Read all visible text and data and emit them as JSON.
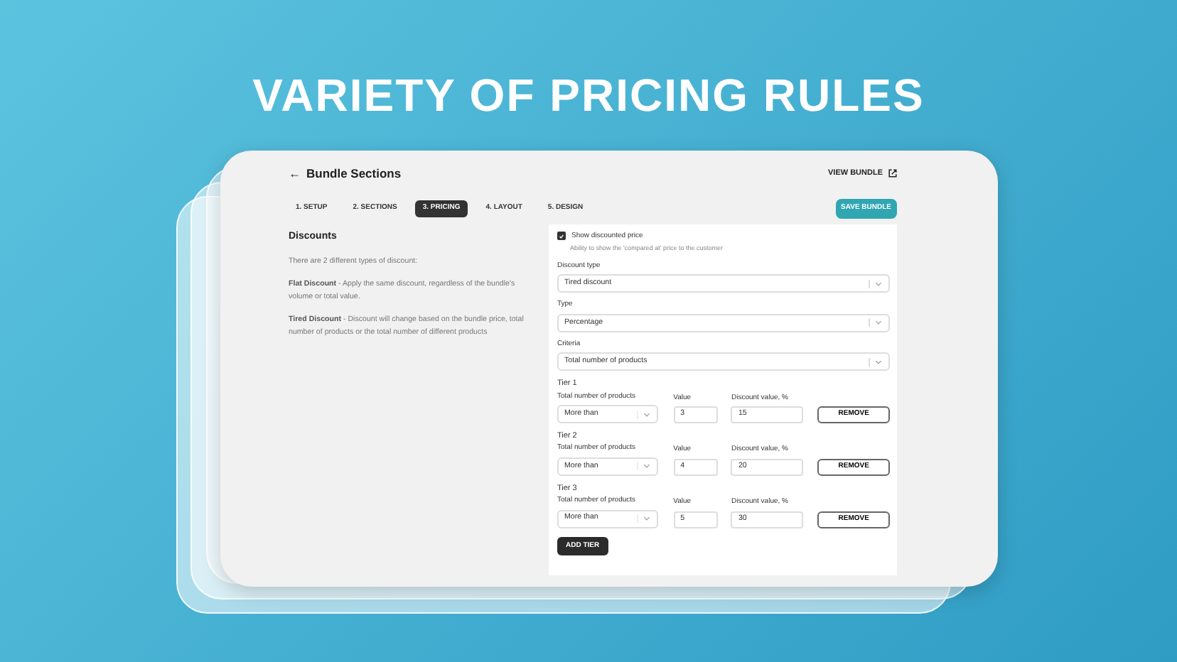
{
  "headline": "VARIETY OF PRICING RULES",
  "header": {
    "back_icon": "←",
    "title": "Bundle Sections",
    "view_link": "VIEW BUNDLE"
  },
  "tabs": [
    {
      "label": "1. SETUP",
      "selected": false
    },
    {
      "label": "2. SECTIONS",
      "selected": false
    },
    {
      "label": "3. PRICING",
      "selected": true
    },
    {
      "label": "4. LAYOUT",
      "selected": false
    },
    {
      "label": "5. DESIGN",
      "selected": false
    }
  ],
  "save_button": "SAVE BUNDLE",
  "info": {
    "title": "Discounts",
    "paragraphs": [
      "There are 2 different types of discount:",
      "**Flat Discount** - Apply the same discount, regardless of the bundle's volume or total value.",
      "**Tired Discount** - Discount will change based on the bundle price, total number of products or the total number of different products"
    ]
  },
  "show_discounted": {
    "label": "Show discounted price",
    "hint": "Ability to show the 'compared at' price to the customer",
    "checked": true
  },
  "selects": [
    {
      "label": "Discount type",
      "value": "Tired discount"
    },
    {
      "label": "Type",
      "value": "Percentage"
    },
    {
      "label": "Criteria",
      "value": "Total number of products"
    }
  ],
  "tiers": [
    {
      "title": "Tier 1",
      "condition_label": "Total number of products",
      "condition": "More than",
      "value_label": "Value",
      "value": "3",
      "discount_label": "Discount value, %",
      "discount": "15",
      "remove": "REMOVE"
    },
    {
      "title": "Tier 2",
      "condition_label": "Total number of products",
      "condition": "More than",
      "value_label": "Value",
      "value": "4",
      "discount_label": "Discount value, %",
      "discount": "20",
      "remove": "REMOVE"
    },
    {
      "title": "Tier 3",
      "condition_label": "Total number of products",
      "condition": "More than",
      "value_label": "Value",
      "value": "5",
      "discount_label": "Discount value, %",
      "discount": "30",
      "remove": "REMOVE"
    }
  ],
  "add_tier": "ADD TIER"
}
